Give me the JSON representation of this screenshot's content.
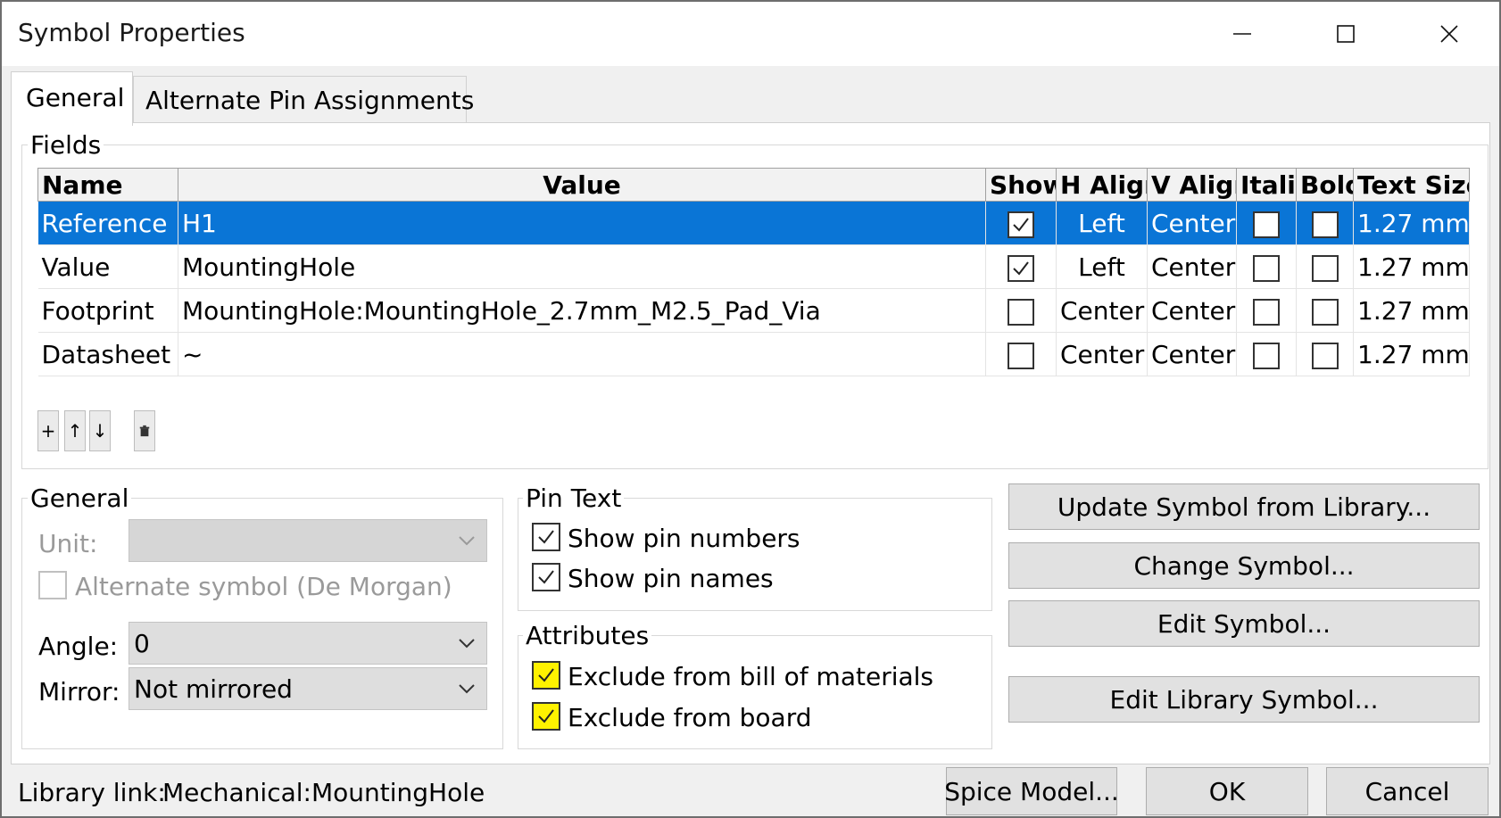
{
  "window": {
    "title": "Symbol Properties",
    "buttons": {
      "minimize_icon": "minimize-icon",
      "maximize_icon": "maximize-icon",
      "close_icon": "close-icon"
    }
  },
  "tabs": [
    {
      "label": "General",
      "active": true
    },
    {
      "label": "Alternate Pin Assignments",
      "active": false
    }
  ],
  "fields": {
    "group_label": "Fields",
    "columns": [
      "Name",
      "Value",
      "Show",
      "H Align",
      "V Align",
      "Italic",
      "Bold",
      "Text Size"
    ],
    "rows": [
      {
        "name": "Reference",
        "value": "H1",
        "show": true,
        "h_align": "Left",
        "v_align": "Center",
        "italic": false,
        "bold": false,
        "text_size": "1.27 mm",
        "selected": true
      },
      {
        "name": "Value",
        "value": "MountingHole",
        "show": true,
        "h_align": "Left",
        "v_align": "Center",
        "italic": false,
        "bold": false,
        "text_size": "1.27 mm",
        "selected": false
      },
      {
        "name": "Footprint",
        "value": "MountingHole:MountingHole_2.7mm_M2.5_Pad_Via",
        "show": false,
        "h_align": "Center",
        "v_align": "Center",
        "italic": false,
        "bold": false,
        "text_size": "1.27 mm",
        "selected": false
      },
      {
        "name": "Datasheet",
        "value": "~",
        "show": false,
        "h_align": "Center",
        "v_align": "Center",
        "italic": false,
        "bold": false,
        "text_size": "1.27 mm",
        "selected": false
      }
    ],
    "tools": {
      "add": "+",
      "up": "↑",
      "down": "↓",
      "delete_icon": "trash-icon"
    }
  },
  "general": {
    "group_label": "General",
    "unit_label": "Unit:",
    "unit_value": "",
    "alternate_label": "Alternate symbol (De Morgan)",
    "alternate_checked": false,
    "angle_label": "Angle:",
    "angle_value": "0",
    "mirror_label": "Mirror:",
    "mirror_value": "Not mirrored"
  },
  "pin_text": {
    "group_label": "Pin Text",
    "show_pin_numbers": "Show pin numbers",
    "show_pin_numbers_checked": true,
    "show_pin_names": "Show pin names",
    "show_pin_names_checked": true
  },
  "attributes": {
    "group_label": "Attributes",
    "exclude_bom": "Exclude from bill of materials",
    "exclude_bom_checked": true,
    "exclude_board": "Exclude from board",
    "exclude_board_checked": true,
    "highlight_color": "#fff200"
  },
  "actions": {
    "update_symbol": "Update Symbol from Library...",
    "change_symbol": "Change Symbol...",
    "edit_symbol": "Edit Symbol...",
    "edit_library_symbol": "Edit Library Symbol..."
  },
  "footer": {
    "library_link_label": "Library link:",
    "library_link_value": "Mechanical:MountingHole",
    "spice_model": "Spice Model...",
    "ok": "OK",
    "cancel": "Cancel"
  },
  "colors": {
    "selection": "#0a75d6",
    "button_bg": "#e1e1e1",
    "dialog_bg": "#f0f0f0"
  }
}
